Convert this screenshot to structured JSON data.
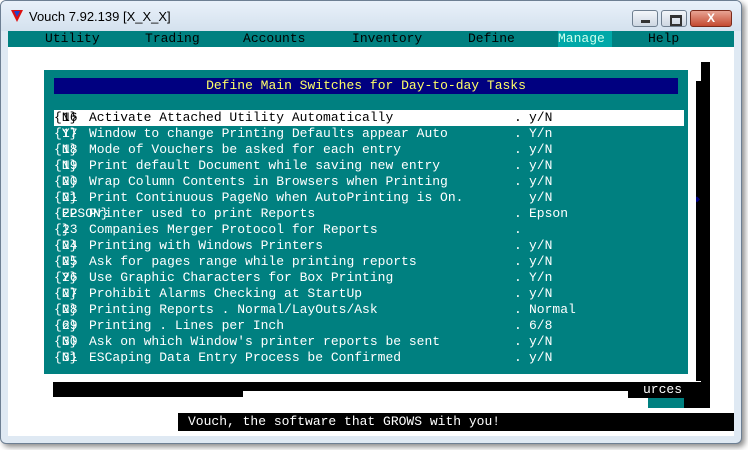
{
  "window": {
    "title": "Vouch  7.92.139  [X_X_X]",
    "minimize_label": "minimize",
    "maximize_label": "maximize",
    "close_label": "X"
  },
  "menu": [
    {
      "hot": "U",
      "rest": "tility"
    },
    {
      "hot": "T",
      "rest": "rading"
    },
    {
      "hot": "A",
      "rest": "ccounts"
    },
    {
      "hot": "I",
      "rest": "nventory"
    },
    {
      "hot": "",
      "rest": "Define"
    },
    {
      "hot": "",
      "rest": "Manage"
    },
    {
      "hot": "H",
      "rest": "elp"
    }
  ],
  "dialog": {
    "title": "Define Main Switches for Day-to-day Tasks",
    "rows": [
      {
        "num": "16",
        "desc": "Activate Attached Utility Automatically",
        "dot": ".",
        "default": "y/N",
        "value": "{N}"
      },
      {
        "num": "17",
        "desc": "Window to change Printing Defaults appear Auto",
        "dot": ".",
        "default": "Y/n",
        "value": "{Y}"
      },
      {
        "num": "18",
        "desc": "Mode of Vouchers be asked for each entry",
        "dot": ".",
        "default": "y/N",
        "value": "{N}"
      },
      {
        "num": "19",
        "desc": "Print default Document while saving new entry",
        "dot": ".",
        "default": "y/N",
        "value": "{N}"
      },
      {
        "num": "20",
        "desc": "Wrap Column Contents in Browsers when Printing",
        "dot": ".",
        "default": "y/N",
        "value": "{N}"
      },
      {
        "num": "21",
        "desc": "Print Continuous PageNo when AutoPrinting is On.",
        "dot": "",
        "default": "y/N",
        "value": "{N}"
      },
      {
        "num": "22",
        "desc": "Printer used to print Reports",
        "dot": ".",
        "default": "Epson",
        "value": "{EPSON}"
      },
      {
        "num": "23",
        "desc": "Companies Merger Protocol for Reports",
        "dot": ".",
        "default": "",
        "value": "{}"
      },
      {
        "num": "24",
        "desc": "Printing with Windows Printers",
        "dot": ".",
        "default": "y/N",
        "value": "{N}"
      },
      {
        "num": "25",
        "desc": "Ask for pages range while printing reports",
        "dot": ".",
        "default": "y/N",
        "value": "{N}"
      },
      {
        "num": "26",
        "desc": "Use Graphic Characters for Box Printing",
        "dot": ".",
        "default": "Y/n",
        "value": "{Y}"
      },
      {
        "num": "27",
        "desc": "Prohibit Alarms Checking at StartUp",
        "dot": ".",
        "default": "y/N",
        "value": "{N}"
      },
      {
        "num": "28",
        "desc": "Printing Reports . Normal/LayOuts/Ask",
        "dot": ".",
        "default": "Normal",
        "value": "{N}"
      },
      {
        "num": "29",
        "desc": "Printing . Lines per Inch",
        "dot": ".",
        "default": "6/8",
        "value": "{6}"
      },
      {
        "num": "30",
        "desc": "Ask on which Window's printer reports be sent",
        "dot": ".",
        "default": "y/N",
        "value": "{N}"
      },
      {
        "num": "31",
        "desc": "ESCaping Data Entry Process be Confirmed",
        "dot": ".",
        "default": "y/N",
        "value": "{N}"
      }
    ]
  },
  "background": {
    "resources_fragment": "urces"
  },
  "status_bar": "Vouch, the software that GROWS with you!"
}
